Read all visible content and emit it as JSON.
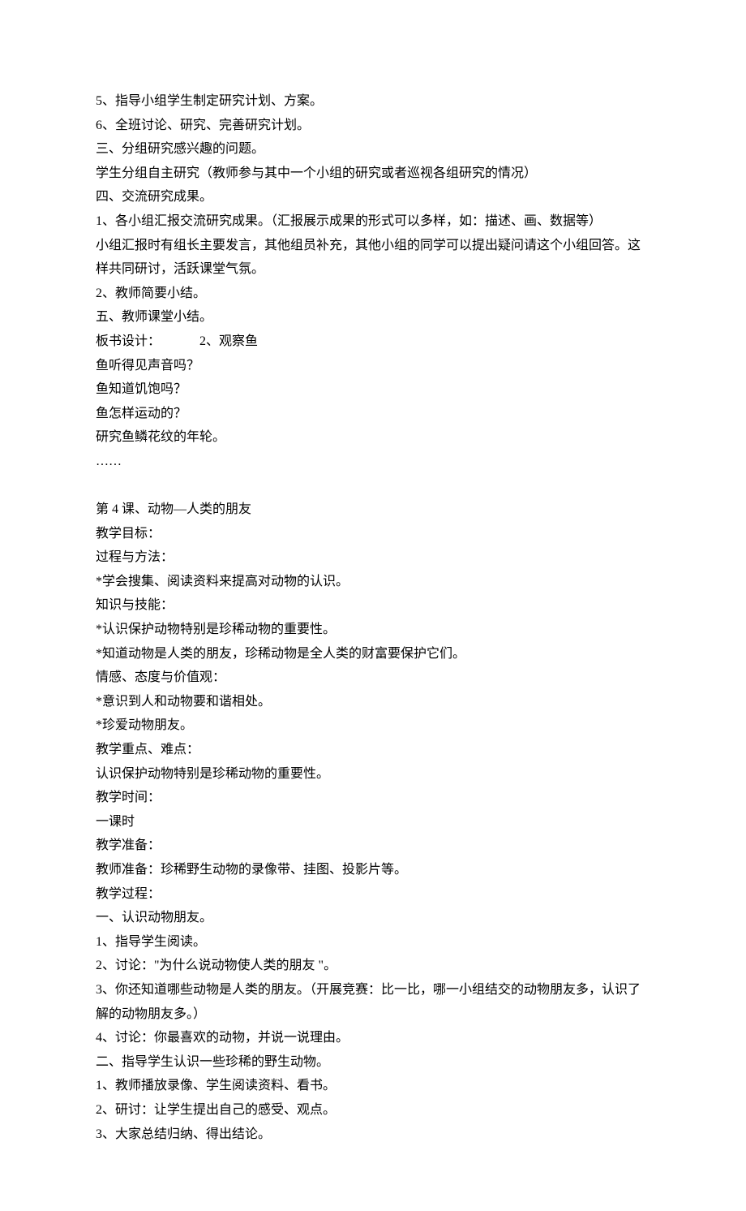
{
  "lines": [
    "5、指导小组学生制定研究计划、方案。",
    "6、全班讨论、研究、完善研究计划。",
    "三、分组研究感兴趣的问题。",
    "学生分组自主研究（教师参与其中一个小组的研究或者巡视各组研究的情况）",
    "四、交流研究成果。",
    "1、各小组汇报交流研究成果。（汇报展示成果的形式可以多样，如：描述、画、数据等）",
    "小组汇报时有组长主要发言，其他组员补充，其他小组的同学可以提出疑问请这个小组回答。这样共同研讨，活跃课堂气氛。",
    "2、教师简要小结。",
    "五、教师课堂小结。",
    "板书设计：            2、观察鱼",
    "鱼听得见声音吗？",
    "鱼知道饥饱吗？",
    "鱼怎样运动的？",
    "研究鱼鳞花纹的年轮。",
    "……",
    "",
    "第 4 课、动物—人类的朋友",
    "教学目标：",
    "过程与方法：",
    "*学会搜集、阅读资料来提高对动物的认识。",
    "知识与技能：",
    "*认识保护动物特别是珍稀动物的重要性。",
    "*知道动物是人类的朋友，珍稀动物是全人类的财富要保护它们。",
    "情感、态度与价值观：",
    "*意识到人和动物要和谐相处。",
    "*珍爱动物朋友。",
    "教学重点、难点：",
    "认识保护动物特别是珍稀动物的重要性。",
    "教学时间：",
    "一课时",
    "教学准备：",
    "教师准备：珍稀野生动物的录像带、挂图、投影片等。",
    "教学过程：",
    "一、认识动物朋友。",
    "1、指导学生阅读。",
    "2、讨论：\"为什么说动物使人类的朋友 \"。",
    "3、你还知道哪些动物是人类的朋友。（开展竞赛：比一比，哪一小组结交的动物朋友多，认识了解的动物朋友多。）",
    "4、讨论：你最喜欢的动物，并说一说理由。",
    "二、指导学生认识一些珍稀的野生动物。",
    "1、教师播放录像、学生阅读资料、看书。",
    "2、研讨：让学生提出自己的感受、观点。",
    "3、大家总结归纳、得出结论。"
  ]
}
